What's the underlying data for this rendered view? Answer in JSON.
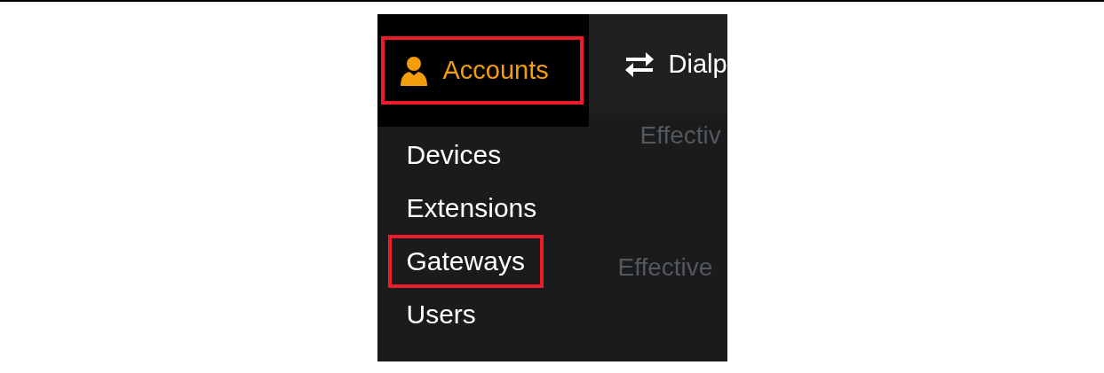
{
  "nav_tabs": [
    {
      "label": "Accounts",
      "selected": true,
      "highlighted": true
    },
    {
      "label": "Dialp",
      "selected": false,
      "highlighted": false
    }
  ],
  "dropdown_menu": {
    "items": [
      {
        "label": "Devices",
        "highlighted": false
      },
      {
        "label": "Extensions",
        "highlighted": false
      },
      {
        "label": "Gateways",
        "highlighted": true
      },
      {
        "label": "Users",
        "highlighted": false
      }
    ]
  },
  "background_content": {
    "texts": [
      "Effectiv",
      "Effective"
    ]
  }
}
